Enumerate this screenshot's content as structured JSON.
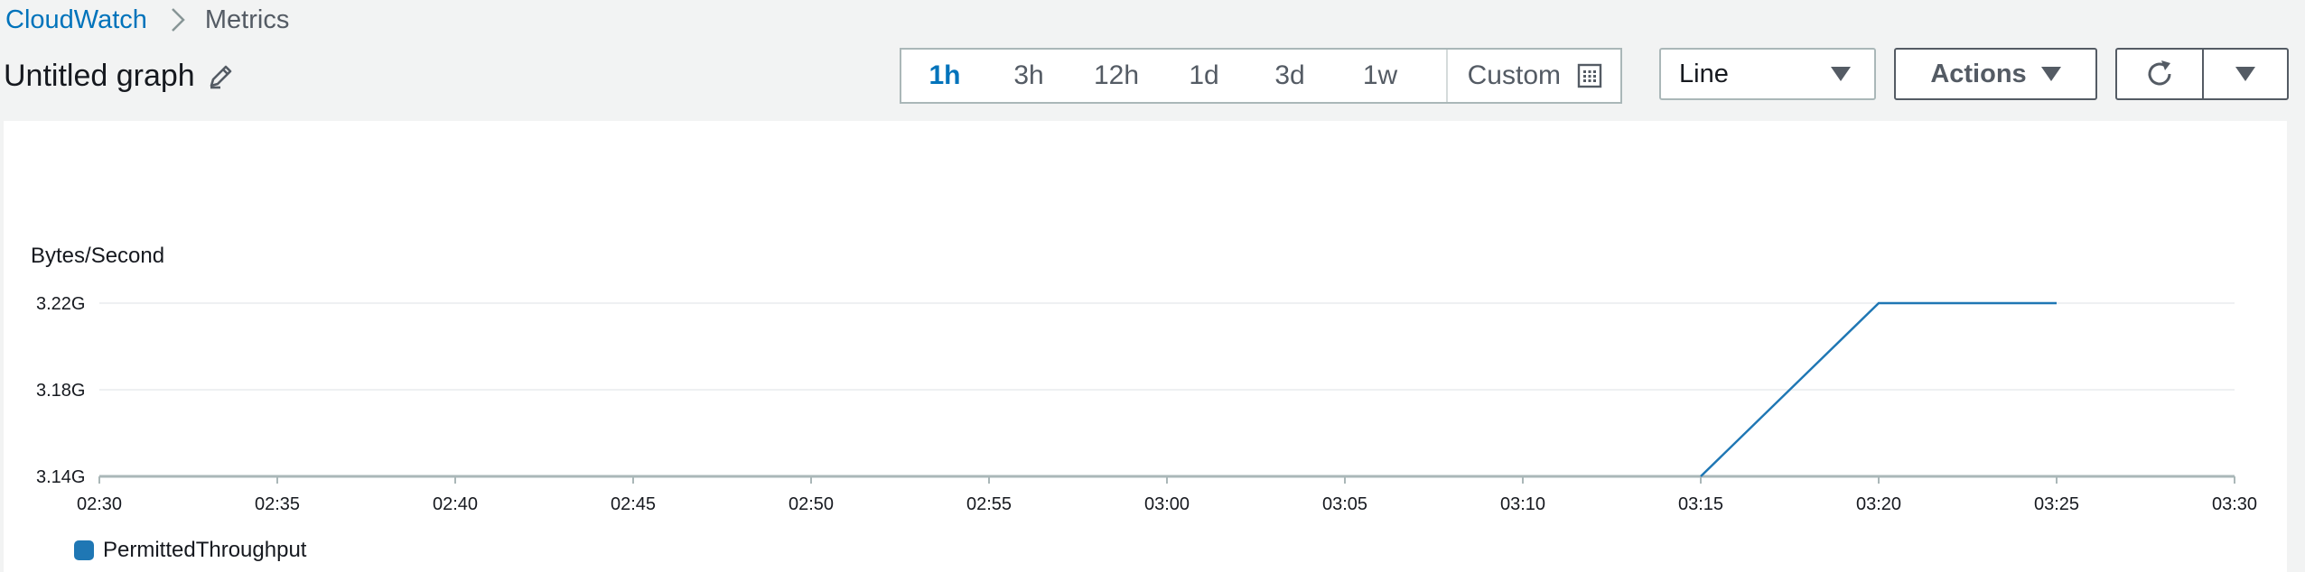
{
  "breadcrumb": {
    "root": "CloudWatch",
    "current": "Metrics"
  },
  "title": "Untitled graph",
  "time_range": {
    "options": [
      "1h",
      "3h",
      "12h",
      "1d",
      "3d",
      "1w"
    ],
    "selected": "1h",
    "custom_label": "Custom"
  },
  "view_select": {
    "value": "Line"
  },
  "actions_label": "Actions",
  "colors": {
    "accent": "#0073bb",
    "series": "#1f77b4"
  },
  "icons": [
    "chevron-right-icon",
    "pencil-icon",
    "calendar-icon",
    "caret-down-icon",
    "refresh-icon"
  ],
  "chart_data": {
    "type": "line",
    "ylabel": "Bytes/Second",
    "yticks": [
      "3.14G",
      "3.18G",
      "3.22G"
    ],
    "ylim": [
      3.14,
      3.22
    ],
    "xticks": [
      "02:30",
      "02:35",
      "02:40",
      "02:45",
      "02:50",
      "02:55",
      "03:00",
      "03:05",
      "03:10",
      "03:15",
      "03:20",
      "03:25",
      "03:30"
    ],
    "xlim": [
      "02:30",
      "03:30"
    ],
    "grid": true,
    "legend_position": "bottom-left",
    "series": [
      {
        "name": "PermittedThroughput",
        "x": [
          "03:15",
          "03:20",
          "03:25"
        ],
        "values": [
          3.14,
          3.22,
          3.22
        ]
      }
    ]
  }
}
